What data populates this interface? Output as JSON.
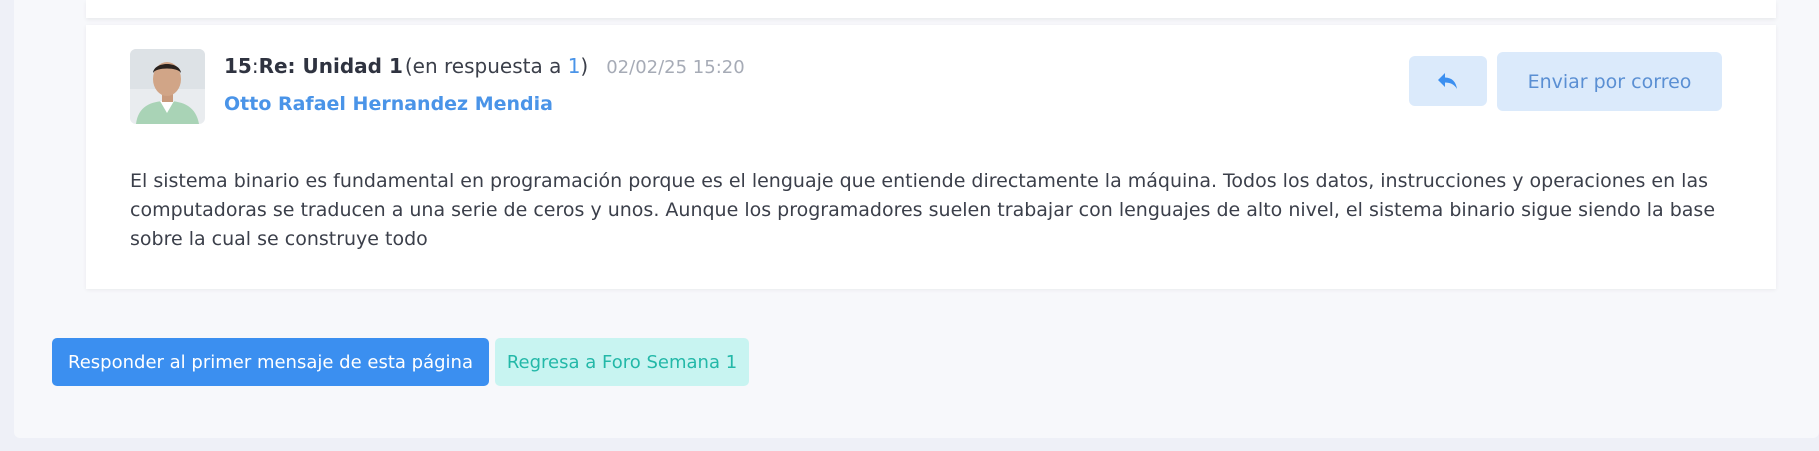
{
  "post": {
    "number": "15",
    "separator": ":",
    "title": "Re: Unidad 1",
    "reply_prefix": "(en respuesta a ",
    "reply_target": "1",
    "reply_suffix": ")",
    "date": "02/02/25 15:20",
    "author": "Otto Rafael Hernandez Mendia",
    "body": "El sistema binario es fundamental en programación porque es el lenguaje que entiende directamente la máquina. Todos los datos, instrucciones y operaciones en las computadoras se traducen a una serie de ceros y unos. Aunque los programadores suelen trabajar con lenguajes de alto nivel, el sistema binario sigue siendo la base sobre la cual se construye todo",
    "reply_icon": "reply-arrow-icon",
    "email_button": "Enviar por correo"
  },
  "actions": {
    "reply_first": "Responder al primer mensaje de esta página",
    "back_to_forum": "Regresa a Foro Semana 1"
  },
  "colors": {
    "accent": "#4a94e8",
    "primary_button": "#3b8ff0",
    "secondary_button_bg": "#c8f4f1",
    "secondary_button_text": "#23b8a8"
  }
}
